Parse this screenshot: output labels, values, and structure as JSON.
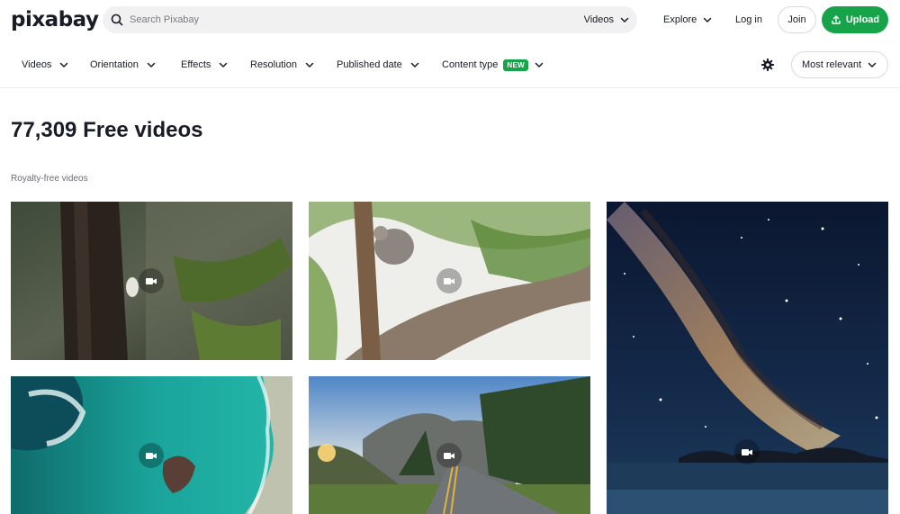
{
  "header": {
    "logo": "pixabay",
    "search_placeholder": "Search Pixabay",
    "search_type": "Videos",
    "explore": "Explore",
    "login": "Log in",
    "join": "Join",
    "upload": "Upload"
  },
  "filters": {
    "items": [
      {
        "label": "Videos"
      },
      {
        "label": "Orientation"
      },
      {
        "label": "Effects"
      },
      {
        "label": "Resolution"
      },
      {
        "label": "Published date"
      },
      {
        "label": "Content type",
        "badge": "NEW"
      }
    ],
    "sort": "Most relevant"
  },
  "main": {
    "title": "77,309 Free videos",
    "subtitle": "Royalty-free videos"
  },
  "videos": [
    {
      "subject": "bird-on-tree-trunk"
    },
    {
      "subject": "koala-in-eucalyptus"
    },
    {
      "subject": "milky-way-over-sea"
    },
    {
      "subject": "aerial-turquoise-coast"
    },
    {
      "subject": "mountain-road-at-sunset"
    }
  ],
  "colors": {
    "brand_green": "#16a34a",
    "text": "#191b26",
    "muted": "#6b6b74"
  }
}
